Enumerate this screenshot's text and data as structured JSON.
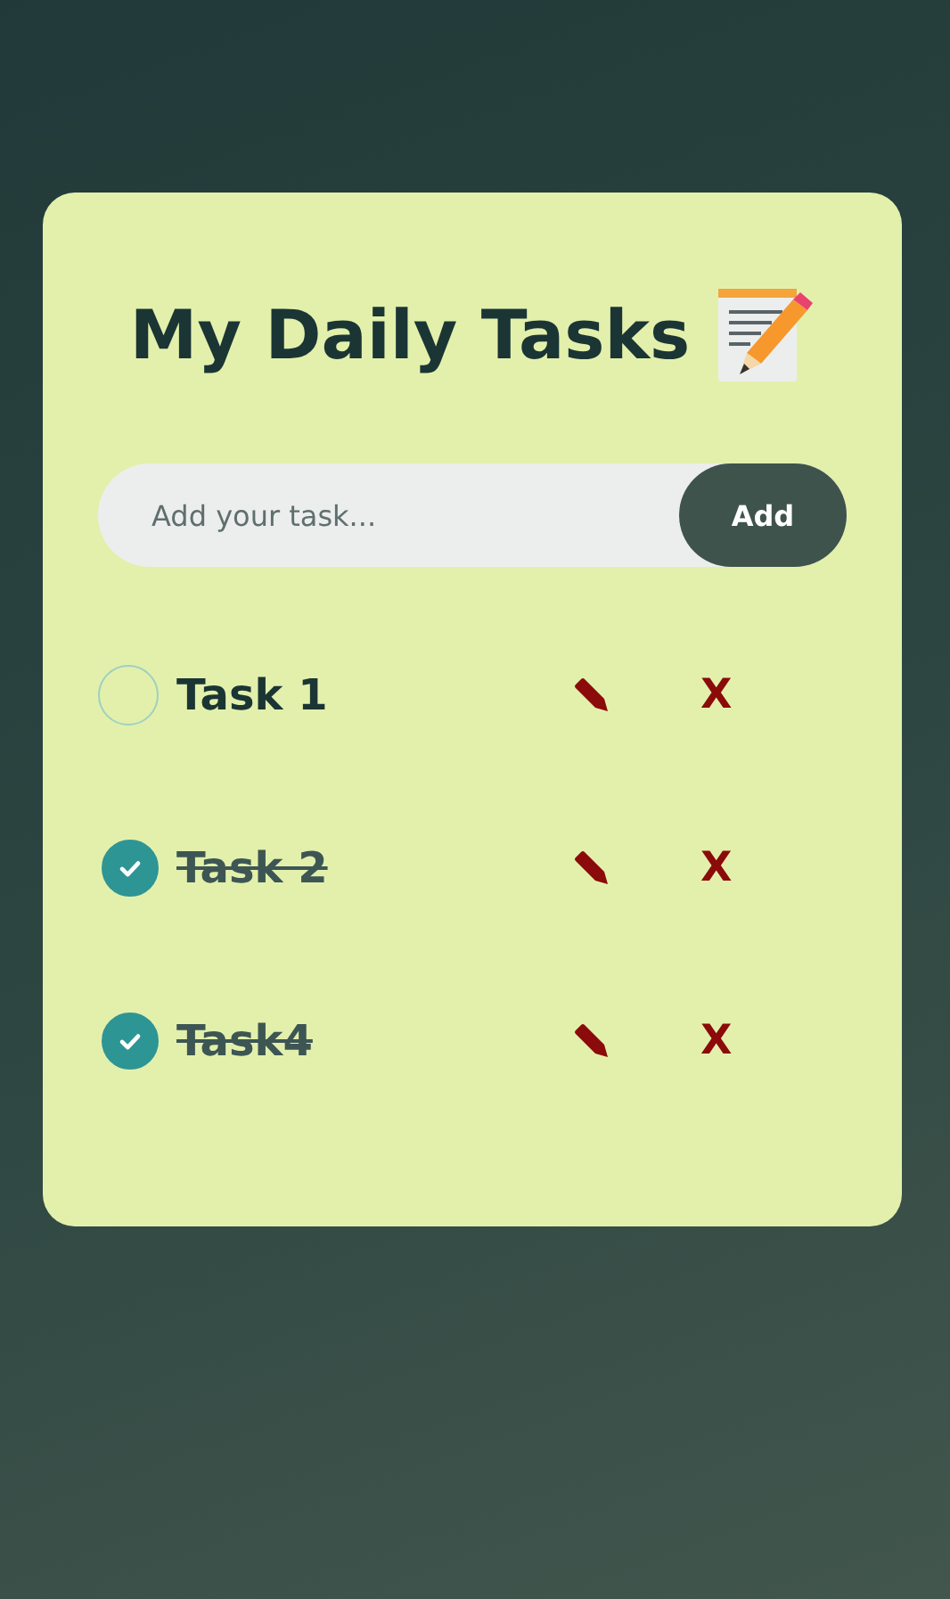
{
  "title": "My Daily Tasks",
  "input": {
    "placeholder": "Add your task..."
  },
  "add_button": "Add",
  "tasks": [
    {
      "label": "Task 1",
      "checked": false,
      "delete": "X"
    },
    {
      "label": "Task 2",
      "checked": true,
      "delete": "X"
    },
    {
      "label": "Task4",
      "checked": true,
      "delete": "X"
    }
  ]
}
